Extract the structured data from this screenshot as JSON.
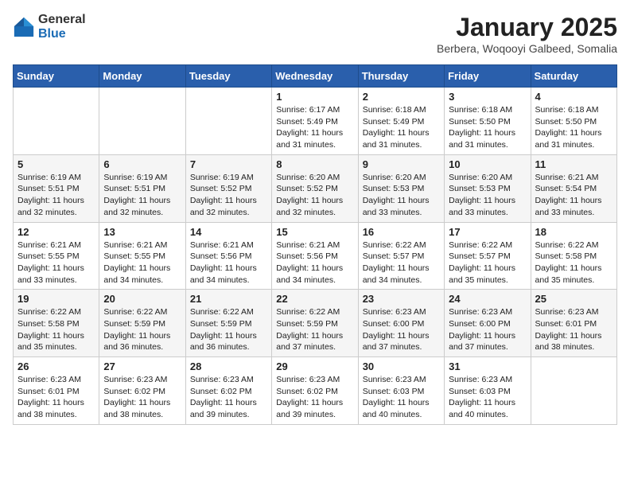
{
  "logo": {
    "general": "General",
    "blue": "Blue"
  },
  "header": {
    "title": "January 2025",
    "location": "Berbera, Woqooyi Galbeed, Somalia"
  },
  "weekdays": [
    "Sunday",
    "Monday",
    "Tuesday",
    "Wednesday",
    "Thursday",
    "Friday",
    "Saturday"
  ],
  "weeks": [
    [
      {
        "day": "",
        "sunrise": "",
        "sunset": "",
        "daylight": ""
      },
      {
        "day": "",
        "sunrise": "",
        "sunset": "",
        "daylight": ""
      },
      {
        "day": "",
        "sunrise": "",
        "sunset": "",
        "daylight": ""
      },
      {
        "day": "1",
        "sunrise": "Sunrise: 6:17 AM",
        "sunset": "Sunset: 5:49 PM",
        "daylight": "Daylight: 11 hours and 31 minutes."
      },
      {
        "day": "2",
        "sunrise": "Sunrise: 6:18 AM",
        "sunset": "Sunset: 5:49 PM",
        "daylight": "Daylight: 11 hours and 31 minutes."
      },
      {
        "day": "3",
        "sunrise": "Sunrise: 6:18 AM",
        "sunset": "Sunset: 5:50 PM",
        "daylight": "Daylight: 11 hours and 31 minutes."
      },
      {
        "day": "4",
        "sunrise": "Sunrise: 6:18 AM",
        "sunset": "Sunset: 5:50 PM",
        "daylight": "Daylight: 11 hours and 31 minutes."
      }
    ],
    [
      {
        "day": "5",
        "sunrise": "Sunrise: 6:19 AM",
        "sunset": "Sunset: 5:51 PM",
        "daylight": "Daylight: 11 hours and 32 minutes."
      },
      {
        "day": "6",
        "sunrise": "Sunrise: 6:19 AM",
        "sunset": "Sunset: 5:51 PM",
        "daylight": "Daylight: 11 hours and 32 minutes."
      },
      {
        "day": "7",
        "sunrise": "Sunrise: 6:19 AM",
        "sunset": "Sunset: 5:52 PM",
        "daylight": "Daylight: 11 hours and 32 minutes."
      },
      {
        "day": "8",
        "sunrise": "Sunrise: 6:20 AM",
        "sunset": "Sunset: 5:52 PM",
        "daylight": "Daylight: 11 hours and 32 minutes."
      },
      {
        "day": "9",
        "sunrise": "Sunrise: 6:20 AM",
        "sunset": "Sunset: 5:53 PM",
        "daylight": "Daylight: 11 hours and 33 minutes."
      },
      {
        "day": "10",
        "sunrise": "Sunrise: 6:20 AM",
        "sunset": "Sunset: 5:53 PM",
        "daylight": "Daylight: 11 hours and 33 minutes."
      },
      {
        "day": "11",
        "sunrise": "Sunrise: 6:21 AM",
        "sunset": "Sunset: 5:54 PM",
        "daylight": "Daylight: 11 hours and 33 minutes."
      }
    ],
    [
      {
        "day": "12",
        "sunrise": "Sunrise: 6:21 AM",
        "sunset": "Sunset: 5:55 PM",
        "daylight": "Daylight: 11 hours and 33 minutes."
      },
      {
        "day": "13",
        "sunrise": "Sunrise: 6:21 AM",
        "sunset": "Sunset: 5:55 PM",
        "daylight": "Daylight: 11 hours and 34 minutes."
      },
      {
        "day": "14",
        "sunrise": "Sunrise: 6:21 AM",
        "sunset": "Sunset: 5:56 PM",
        "daylight": "Daylight: 11 hours and 34 minutes."
      },
      {
        "day": "15",
        "sunrise": "Sunrise: 6:21 AM",
        "sunset": "Sunset: 5:56 PM",
        "daylight": "Daylight: 11 hours and 34 minutes."
      },
      {
        "day": "16",
        "sunrise": "Sunrise: 6:22 AM",
        "sunset": "Sunset: 5:57 PM",
        "daylight": "Daylight: 11 hours and 34 minutes."
      },
      {
        "day": "17",
        "sunrise": "Sunrise: 6:22 AM",
        "sunset": "Sunset: 5:57 PM",
        "daylight": "Daylight: 11 hours and 35 minutes."
      },
      {
        "day": "18",
        "sunrise": "Sunrise: 6:22 AM",
        "sunset": "Sunset: 5:58 PM",
        "daylight": "Daylight: 11 hours and 35 minutes."
      }
    ],
    [
      {
        "day": "19",
        "sunrise": "Sunrise: 6:22 AM",
        "sunset": "Sunset: 5:58 PM",
        "daylight": "Daylight: 11 hours and 35 minutes."
      },
      {
        "day": "20",
        "sunrise": "Sunrise: 6:22 AM",
        "sunset": "Sunset: 5:59 PM",
        "daylight": "Daylight: 11 hours and 36 minutes."
      },
      {
        "day": "21",
        "sunrise": "Sunrise: 6:22 AM",
        "sunset": "Sunset: 5:59 PM",
        "daylight": "Daylight: 11 hours and 36 minutes."
      },
      {
        "day": "22",
        "sunrise": "Sunrise: 6:22 AM",
        "sunset": "Sunset: 5:59 PM",
        "daylight": "Daylight: 11 hours and 37 minutes."
      },
      {
        "day": "23",
        "sunrise": "Sunrise: 6:23 AM",
        "sunset": "Sunset: 6:00 PM",
        "daylight": "Daylight: 11 hours and 37 minutes."
      },
      {
        "day": "24",
        "sunrise": "Sunrise: 6:23 AM",
        "sunset": "Sunset: 6:00 PM",
        "daylight": "Daylight: 11 hours and 37 minutes."
      },
      {
        "day": "25",
        "sunrise": "Sunrise: 6:23 AM",
        "sunset": "Sunset: 6:01 PM",
        "daylight": "Daylight: 11 hours and 38 minutes."
      }
    ],
    [
      {
        "day": "26",
        "sunrise": "Sunrise: 6:23 AM",
        "sunset": "Sunset: 6:01 PM",
        "daylight": "Daylight: 11 hours and 38 minutes."
      },
      {
        "day": "27",
        "sunrise": "Sunrise: 6:23 AM",
        "sunset": "Sunset: 6:02 PM",
        "daylight": "Daylight: 11 hours and 38 minutes."
      },
      {
        "day": "28",
        "sunrise": "Sunrise: 6:23 AM",
        "sunset": "Sunset: 6:02 PM",
        "daylight": "Daylight: 11 hours and 39 minutes."
      },
      {
        "day": "29",
        "sunrise": "Sunrise: 6:23 AM",
        "sunset": "Sunset: 6:02 PM",
        "daylight": "Daylight: 11 hours and 39 minutes."
      },
      {
        "day": "30",
        "sunrise": "Sunrise: 6:23 AM",
        "sunset": "Sunset: 6:03 PM",
        "daylight": "Daylight: 11 hours and 40 minutes."
      },
      {
        "day": "31",
        "sunrise": "Sunrise: 6:23 AM",
        "sunset": "Sunset: 6:03 PM",
        "daylight": "Daylight: 11 hours and 40 minutes."
      },
      {
        "day": "",
        "sunrise": "",
        "sunset": "",
        "daylight": ""
      }
    ]
  ]
}
